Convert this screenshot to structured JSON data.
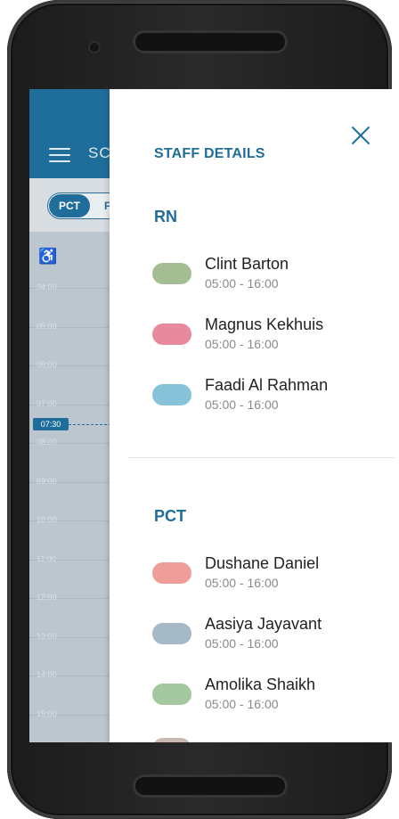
{
  "app": {
    "header_title": "SC",
    "chip_active": "PCT",
    "chip_next": "F",
    "now_time": "07:30",
    "times": [
      "04:00",
      "05:00",
      "06:00",
      "07:00",
      "08:00",
      "09:00",
      "10:00",
      "11:00",
      "12:00",
      "13:00",
      "14:00",
      "15:00"
    ]
  },
  "drawer": {
    "title": "STAFF DETAILS",
    "sections": [
      {
        "title": "RN",
        "staff": [
          {
            "name": "Clint Barton",
            "time": "05:00 - 16:00",
            "color": "#a4bd93"
          },
          {
            "name": "Magnus Kekhuis",
            "time": "05:00 - 16:00",
            "color": "#e78a9e"
          },
          {
            "name": "Faadi Al Rahman",
            "time": "05:00 - 16:00",
            "color": "#86c3d9"
          }
        ]
      },
      {
        "title": "PCT",
        "staff": [
          {
            "name": "Dushane Daniel",
            "time": "05:00 - 16:00",
            "color": "#ee9d98"
          },
          {
            "name": "Aasiya Jayavant",
            "time": "05:00 - 16:00",
            "color": "#a6b9c6"
          },
          {
            "name": "Amolika Shaikh",
            "time": "05:00 - 16:00",
            "color": "#a3c79e"
          }
        ]
      }
    ]
  },
  "colors": {
    "accent": "#1f6d9b"
  }
}
